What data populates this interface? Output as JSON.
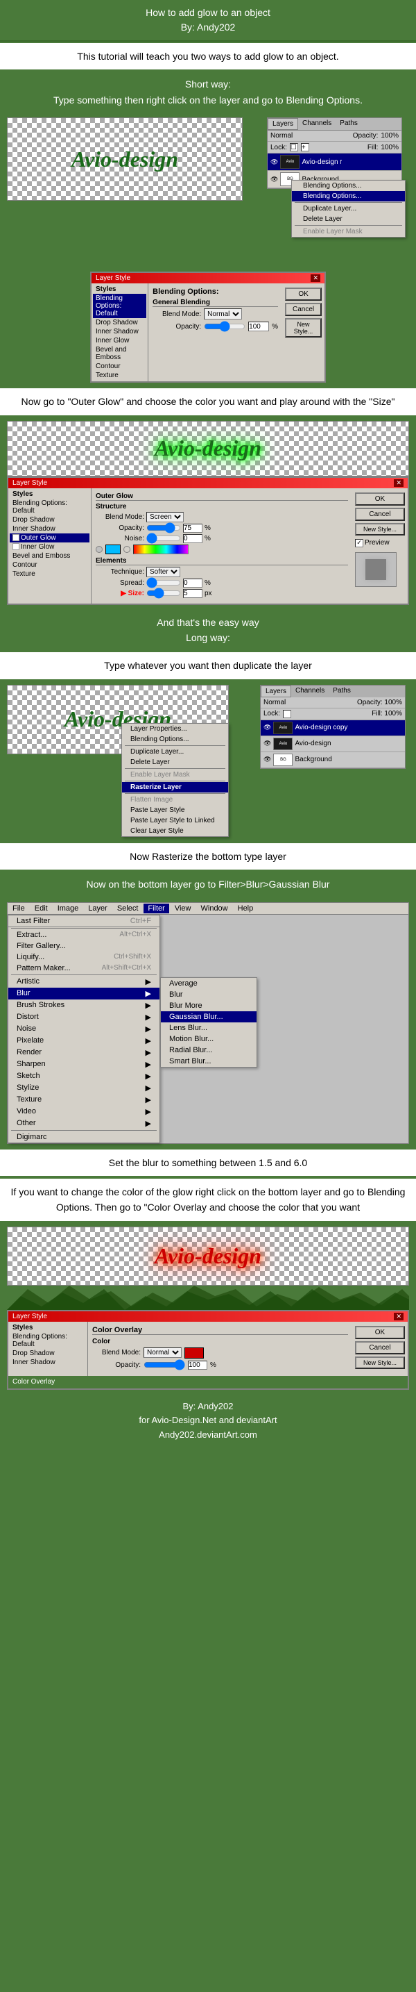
{
  "header": {
    "title": "How to add glow to an object",
    "author": "By: Andy202"
  },
  "intro": {
    "text1": "This tutorial will teach you two ways to add glow to an object.",
    "short_way_label": "Short way:",
    "short_way_desc": "Type something then right click on the layer and go to Blending Options."
  },
  "layer_style_1": {
    "title": "Layer Style",
    "sections": {
      "blending_options_label": "Blending Options:",
      "general_blending": "General Blending",
      "blend_mode_label": "Blend Mode:",
      "blend_mode_value": "Normal",
      "opacity_label": "Opacity:",
      "opacity_value": "100",
      "ok_label": "OK",
      "cancel_label": "Cancel",
      "new_style_label": "New Style..."
    },
    "styles": [
      "Styles",
      "Blending Options: Default",
      "Drop Shadow",
      "Inner Shadow",
      "Inner Glow",
      "Bevel and Emboss",
      "Contour",
      "Texture"
    ]
  },
  "instruction_2": {
    "text": "Now go to \"Outer Glow\" and choose the color you want and play around with the \"Size\""
  },
  "layer_style_2": {
    "title": "Layer Style",
    "outer_glow": {
      "label": "Outer Glow",
      "structure": "Structure",
      "blend_mode": "Screen",
      "opacity": "75",
      "noise": "0",
      "elements": "Elements",
      "technique": "Softer",
      "spread": "0",
      "size": "5"
    },
    "buttons": {
      "ok": "OK",
      "cancel": "Cancel",
      "new_style": "New Style...",
      "preview": "Preview"
    },
    "styles": [
      "Styles",
      "Blending Options: Default",
      "Drop Shadow",
      "Inner Shadow",
      "Outer Glow",
      "Inner Glow",
      "Bevel and Emboss",
      "Contour",
      "Texture"
    ]
  },
  "easy_way_end": {
    "text": "And that's the easy way",
    "long_way_label": "Long way:"
  },
  "long_way_desc": {
    "text": "Type whatever you want then duplicate the layer"
  },
  "context_menu_1": {
    "items": [
      "Layer Properties...",
      "Blending Options...",
      "Duplicate Layer...",
      "Delete Layer",
      "Enable Layer Mask",
      "Rasterize Layer",
      "",
      "Flatten Image",
      "Paste Layer Style",
      "Paste Layer Style to Linked",
      "Clear Layer Style"
    ]
  },
  "rasterize_instruction": {
    "text": "Now Rasterize the bottom type layer"
  },
  "filter_instruction": {
    "text": "Now on the bottom layer go to Filter>Blur>Gaussian Blur"
  },
  "filter_menu": {
    "bar_items": [
      "Last Filter",
      "Ctrl+F",
      "Extract...",
      "Alt+Ctrl+X",
      "Filter Gallery...",
      "Liquify...",
      "Ctrl+Shift+X",
      "Pattern Maker...",
      "Alt+Shift+Ctrl+X"
    ],
    "items": [
      "Artistic",
      "Blur",
      "Brush Strokes",
      "Distort",
      "Noise",
      "Pixelate",
      "Render",
      "Sharpen",
      "Sketch",
      "Stylize",
      "Texture",
      "Video",
      "Other",
      "Digimarc"
    ],
    "blur_items": [
      "Average",
      "Blur",
      "Blur More",
      "Gaussian Blur...",
      "Lens Blur...",
      "Motion Blur...",
      "Radial Blur...",
      "Smart Blur..."
    ]
  },
  "blur_instruction": {
    "text": "Set the blur to something between 1.5 and 6.0"
  },
  "color_overlay_instruction": {
    "text1": "If you want to change the color of the glow right click on the bottom layer and go to Blending Options.  Then go to \"Color Overlay and choose the color that you want"
  },
  "layer_style_3": {
    "title": "Layer Style",
    "color_overlay": {
      "label": "Color Overlay",
      "color_section": "Color",
      "blend_mode": "Normal",
      "opacity": "100"
    },
    "buttons": {
      "ok": "OK",
      "cancel": "Cancel",
      "new_style": "New Style..."
    },
    "styles": [
      "Styles",
      "Blending Options: Default",
      "Drop Shadow",
      "Inner Shadow"
    ]
  },
  "footer": {
    "line1": "By: Andy202",
    "line2": "for Avio-Design.Net and deviantArt",
    "line3": "Andy202.deviantArt.com"
  },
  "avio_text": "Avio-design",
  "canvas_bg": "checkerboard"
}
